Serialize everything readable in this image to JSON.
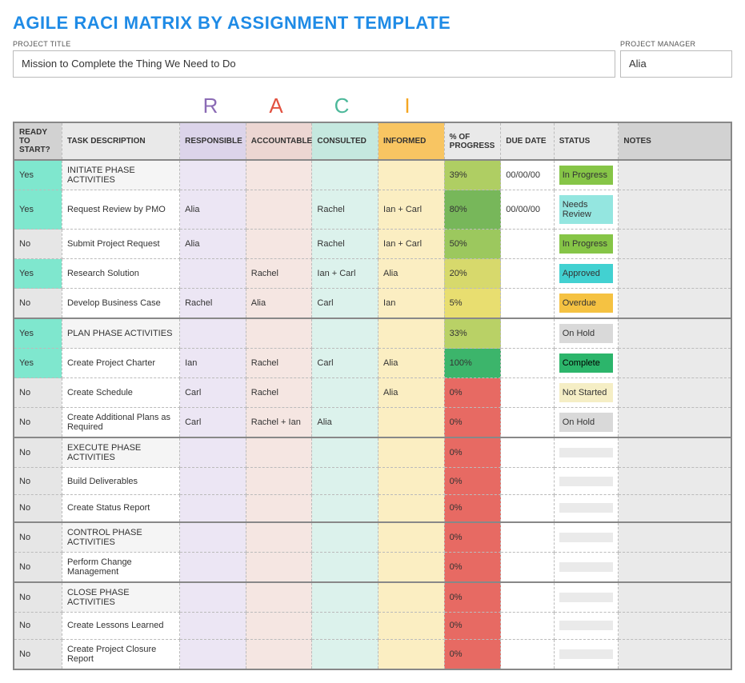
{
  "title": "AGILE RACI MATRIX BY ASSIGNMENT TEMPLATE",
  "meta": {
    "projectTitleLabel": "PROJECT TITLE",
    "projectTitle": "Mission to Complete the Thing We Need to Do",
    "projectManagerLabel": "PROJECT MANAGER",
    "projectManager": "Alia"
  },
  "raciLetters": {
    "r": "R",
    "a": "A",
    "c": "C",
    "i": "I"
  },
  "headers": {
    "ready": "READY TO START?",
    "task": "TASK DESCRIPTION",
    "responsible": "RESPONSIBLE",
    "accountable": "ACCOUNTABLE",
    "consulted": "CONSULTED",
    "informed": "INFORMED",
    "progress": "% of PROGRESS",
    "due": "DUE DATE",
    "status": "STATUS",
    "notes": "NOTES"
  },
  "rows": [
    {
      "section": true,
      "ready": "Yes",
      "task": "INITIATE PHASE ACTIVITIES",
      "resp": "",
      "acc": "",
      "cons": "",
      "inf": "",
      "progress": "39%",
      "progCls": "pg-39",
      "due": "00/00/00",
      "status": "In Progress",
      "statCls": "st-in-progress",
      "notes": ""
    },
    {
      "ready": "Yes",
      "task": "Request Review by PMO",
      "resp": "Alia",
      "acc": "",
      "cons": "Rachel",
      "inf": "Ian + Carl",
      "progress": "80%",
      "progCls": "pg-80",
      "due": "00/00/00",
      "status": "Needs Review",
      "statCls": "st-needs-review",
      "notes": ""
    },
    {
      "ready": "No",
      "task": "Submit Project Request",
      "resp": "Alia",
      "acc": "",
      "cons": "Rachel",
      "inf": "Ian + Carl",
      "progress": "50%",
      "progCls": "pg-50",
      "due": "",
      "status": "In Progress",
      "statCls": "st-in-progress",
      "notes": ""
    },
    {
      "ready": "Yes",
      "task": "Research Solution",
      "resp": "",
      "acc": "Rachel",
      "cons": "Ian + Carl",
      "inf": "Alia",
      "progress": "20%",
      "progCls": "pg-20",
      "due": "",
      "status": "Approved",
      "statCls": "st-approved",
      "notes": ""
    },
    {
      "ready": "No",
      "task": "Develop Business Case",
      "resp": "Rachel",
      "acc": "Alia",
      "cons": "Carl",
      "inf": "Ian",
      "progress": "5%",
      "progCls": "pg-5",
      "due": "",
      "status": "Overdue",
      "statCls": "st-overdue",
      "notes": ""
    },
    {
      "section": true,
      "ready": "Yes",
      "task": "PLAN PHASE ACTIVITIES",
      "resp": "",
      "acc": "",
      "cons": "",
      "inf": "",
      "progress": "33%",
      "progCls": "pg-33",
      "due": "",
      "status": "On Hold",
      "statCls": "st-on-hold",
      "notes": ""
    },
    {
      "ready": "Yes",
      "task": "Create Project Charter",
      "resp": "Ian",
      "acc": "Rachel",
      "cons": "Carl",
      "inf": "Alia",
      "progress": "100%",
      "progCls": "pg-100",
      "due": "",
      "status": "Complete",
      "statCls": "st-complete",
      "notes": ""
    },
    {
      "ready": "No",
      "task": "Create Schedule",
      "resp": "Carl",
      "acc": "Rachel",
      "cons": "",
      "inf": "Alia",
      "progress": "0%",
      "progCls": "pg-0",
      "due": "",
      "status": "Not Started",
      "statCls": "st-not-started",
      "notes": ""
    },
    {
      "ready": "No",
      "task": "Create Additional Plans as Required",
      "resp": "Carl",
      "acc": "Rachel + Ian",
      "cons": "Alia",
      "inf": "",
      "progress": "0%",
      "progCls": "pg-0",
      "due": "",
      "status": "On Hold",
      "statCls": "st-on-hold",
      "notes": ""
    },
    {
      "section": true,
      "ready": "No",
      "task": "EXECUTE PHASE ACTIVITIES",
      "resp": "",
      "acc": "",
      "cons": "",
      "inf": "",
      "progress": "0%",
      "progCls": "pg-0",
      "due": "",
      "status": "",
      "statCls": "st-blank",
      "notes": ""
    },
    {
      "ready": "No",
      "task": "Build Deliverables",
      "resp": "",
      "acc": "",
      "cons": "",
      "inf": "",
      "progress": "0%",
      "progCls": "pg-0",
      "due": "",
      "status": "",
      "statCls": "st-blank",
      "notes": ""
    },
    {
      "ready": "No",
      "task": "Create Status Report",
      "resp": "",
      "acc": "",
      "cons": "",
      "inf": "",
      "progress": "0%",
      "progCls": "pg-0",
      "due": "",
      "status": "",
      "statCls": "st-blank",
      "notes": ""
    },
    {
      "section": true,
      "ready": "No",
      "task": "CONTROL PHASE ACTIVITIES",
      "resp": "",
      "acc": "",
      "cons": "",
      "inf": "",
      "progress": "0%",
      "progCls": "pg-0",
      "due": "",
      "status": "",
      "statCls": "st-blank",
      "notes": ""
    },
    {
      "ready": "No",
      "task": "Perform Change Management",
      "resp": "",
      "acc": "",
      "cons": "",
      "inf": "",
      "progress": "0%",
      "progCls": "pg-0",
      "due": "",
      "status": "",
      "statCls": "st-blank",
      "notes": ""
    },
    {
      "section": true,
      "ready": "No",
      "task": "CLOSE PHASE ACTIVITIES",
      "resp": "",
      "acc": "",
      "cons": "",
      "inf": "",
      "progress": "0%",
      "progCls": "pg-0",
      "due": "",
      "status": "",
      "statCls": "st-blank",
      "notes": ""
    },
    {
      "ready": "No",
      "task": "Create Lessons Learned",
      "resp": "",
      "acc": "",
      "cons": "",
      "inf": "",
      "progress": "0%",
      "progCls": "pg-0",
      "due": "",
      "status": "",
      "statCls": "st-blank",
      "notes": ""
    },
    {
      "ready": "No",
      "task": "Create Project Closure Report",
      "resp": "",
      "acc": "",
      "cons": "",
      "inf": "",
      "progress": "0%",
      "progCls": "pg-0",
      "due": "",
      "status": "",
      "statCls": "st-blank",
      "notes": ""
    }
  ]
}
